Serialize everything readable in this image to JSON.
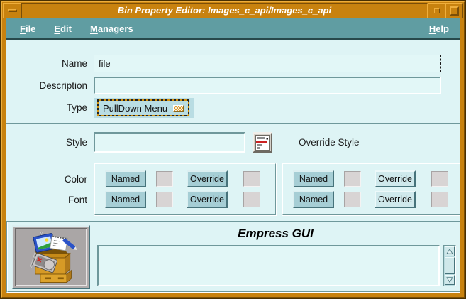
{
  "window": {
    "title": "Bin Property Editor: Images_c_api/Images_c_api"
  },
  "menubar": {
    "items": [
      {
        "label": "File"
      },
      {
        "label": "Edit"
      },
      {
        "label": "Managers"
      }
    ],
    "help_label": "Help"
  },
  "form": {
    "name_label": "Name",
    "name_value": "file",
    "description_label": "Description",
    "description_value": "",
    "type_label": "Type",
    "type_value": "PullDown Menu",
    "style_label": "Style",
    "style_value": "",
    "override_style_label": "Override Style"
  },
  "groups": {
    "color_label": "Color",
    "font_label": "Font",
    "named_label": "Named",
    "override_label": "Override"
  },
  "footer": {
    "brand": "Empress GUI",
    "text_value": ""
  },
  "icons": [
    "window-menu-icon",
    "minimize-icon",
    "maximize-icon",
    "option-menu-icon",
    "style-list-picker-icon",
    "toolbox-logo-icon",
    "scroll-up-icon",
    "scroll-down-icon"
  ],
  "colors": {
    "frame_orange": "#c8820f",
    "menubar_teal": "#609da2",
    "client_bg": "#def4f5",
    "button_face": "#a6ced5",
    "button_face_light": "#cfe9ec",
    "focus_checker": "#d4920a",
    "picker_red": "#cc2222"
  }
}
